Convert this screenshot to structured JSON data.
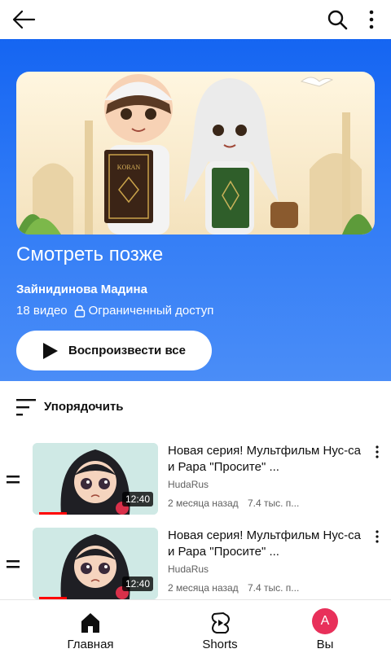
{
  "playlist": {
    "title": "Смотреть позже",
    "author": "Зайнидинова Мадина",
    "video_count": "18 видео",
    "access": "Ограниченный доступ",
    "play_all_label": "Воспроизвести все",
    "thumbnail_book_text": "KORAN"
  },
  "sort": {
    "label": "Упорядочить"
  },
  "videos": [
    {
      "title": "Новая серия! Мультфильм Нус-са и Рара \"Просите\" ...",
      "channel": "HudaRus",
      "age": "2 месяца назад",
      "views": "7.4 тыс. п...",
      "duration": "12:40"
    },
    {
      "title": "Новая серия! Мультфильм Нус-са и Рара \"Просите\" ...",
      "channel": "HudaRus",
      "age": "2 месяца назад",
      "views": "7.4 тыс. п...",
      "duration": "12:40"
    }
  ],
  "bottom_nav": {
    "home": "Главная",
    "shorts": "Shorts",
    "you": "Вы",
    "avatar_letter": "A"
  },
  "colors": {
    "hero_top": "#1565f2",
    "hero_bottom": "#4a8df7",
    "progress": "#ff0000",
    "avatar": "#e8305a"
  },
  "icons": [
    "back-arrow-icon",
    "search-icon",
    "more-vert-icon",
    "lock-icon",
    "play-icon",
    "sort-icon",
    "drag-handle-icon",
    "home-icon",
    "shorts-icon"
  ]
}
